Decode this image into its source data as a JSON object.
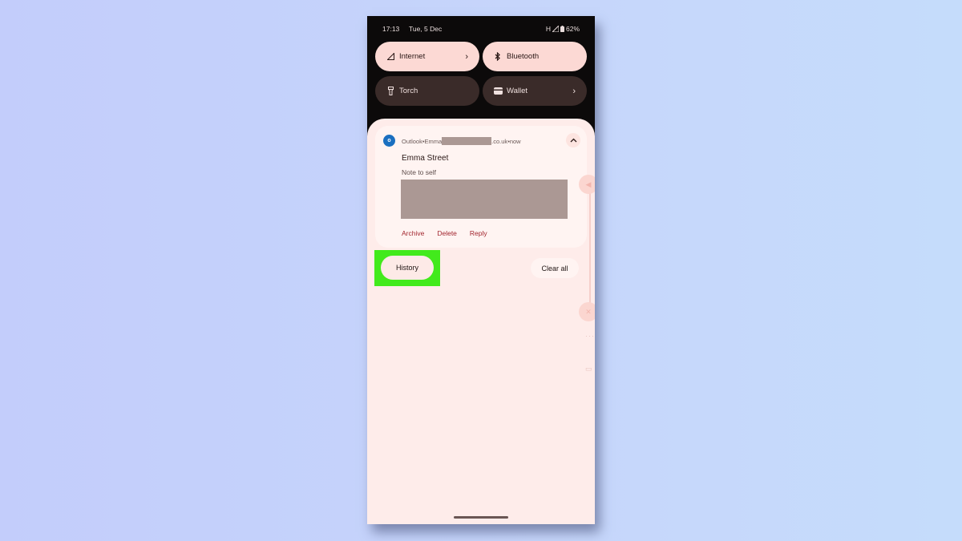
{
  "status_bar": {
    "time": "17:13",
    "date": "Tue, 5 Dec",
    "network": "H",
    "battery": "62%"
  },
  "quick_settings": [
    {
      "label": "Internet",
      "icon": "signal-icon",
      "state": "on",
      "has_chevron": true
    },
    {
      "label": "Bluetooth",
      "icon": "bluetooth-icon",
      "state": "on",
      "has_chevron": false
    },
    {
      "label": "Torch",
      "icon": "torch-icon",
      "state": "off",
      "has_chevron": false
    },
    {
      "label": "Wallet",
      "icon": "wallet-icon",
      "state": "off",
      "has_chevron": true
    }
  ],
  "chevron_glyph": "›",
  "notification": {
    "app": "Outlook",
    "sep": " • ",
    "account_prefix": "Emma",
    "account_suffix": ".co.uk",
    "time": "now",
    "sender": "Emma Street",
    "subject": "Note to self",
    "actions": [
      "Archive",
      "Delete",
      "Reply"
    ],
    "accent_color": "#a2262f"
  },
  "footer": {
    "history_label": "History",
    "clear_all_label": "Clear all",
    "highlight_color": "#42ea1c"
  }
}
